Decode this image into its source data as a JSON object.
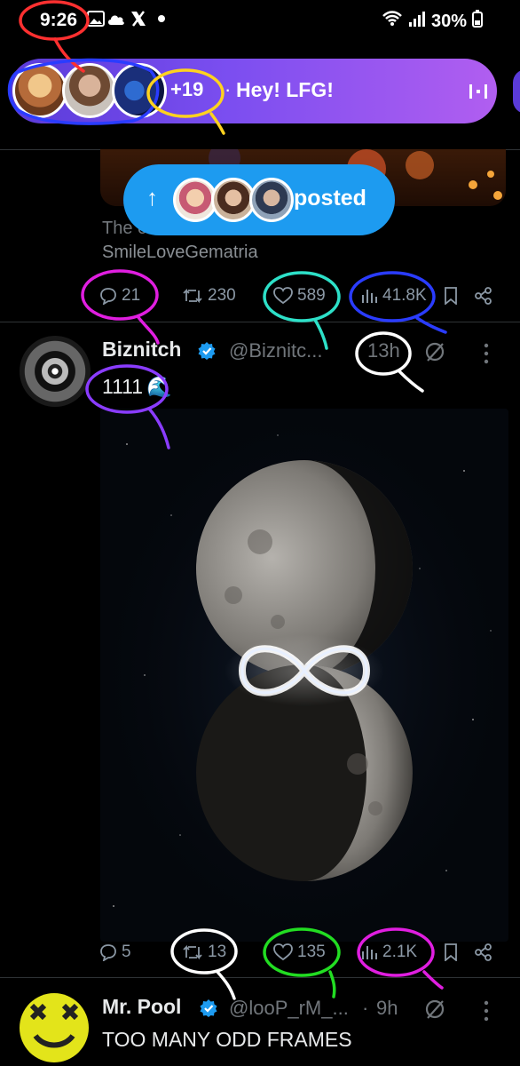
{
  "status_bar": {
    "time": "9:26",
    "battery": "30%",
    "icons": [
      "gallery-icon",
      "cloud-icon",
      "x-logo-icon",
      "dot-icon",
      "wifi-icon",
      "signal-icon",
      "battery-icon"
    ]
  },
  "spaces": {
    "count": "+19",
    "separator": "·",
    "title": "Hey!  LFG!",
    "gradient": [
      "#5a3bd9",
      "#b15ef0"
    ]
  },
  "toast": {
    "arrow": "↑",
    "label": "posted",
    "color": "#1d9bf0"
  },
  "previous_tweet": {
    "text_partial": "The c",
    "text_line2": "SmileLoveGematria",
    "replies": "21",
    "reposts": "230",
    "likes": "589",
    "views": "41.8K"
  },
  "tweet1": {
    "name": "Biznitch",
    "handle": "@Biznitc...",
    "time": "13h",
    "text": "1111",
    "emoji": "🌊",
    "replies": "5",
    "reposts": "13",
    "likes": "135",
    "views": "2.1K"
  },
  "tweet2": {
    "name": "Mr. Pool",
    "handle": "@looP_rM_...",
    "separator": "·",
    "time": "9h",
    "text": "TOO MANY ODD FRAMES"
  },
  "colors": {
    "background": "#000000",
    "accent": "#1d9bf0",
    "muted": "#71767b",
    "annotation_red": "#ff3030",
    "annotation_yellow": "#ffd21f",
    "annotation_magenta": "#e01ee0",
    "annotation_cyan": "#2de0c8",
    "annotation_blue": "#2a3cff",
    "annotation_purple": "#8a3cff",
    "annotation_white": "#ffffff",
    "annotation_green": "#22dd22"
  }
}
